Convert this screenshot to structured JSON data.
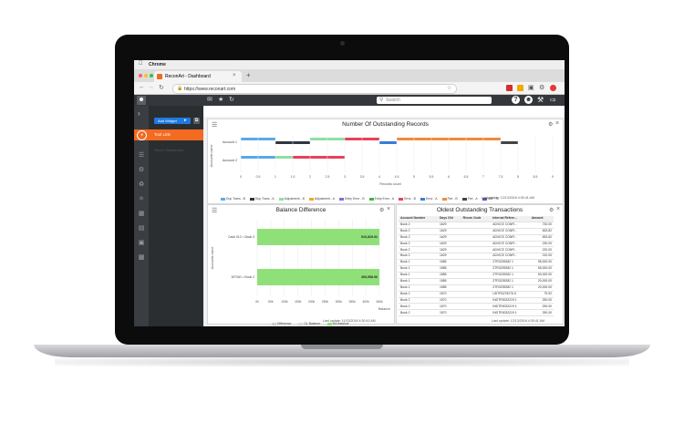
{
  "os": {
    "app_name": "Chrome"
  },
  "browser": {
    "tab_title": "ReconArt - Dashboard",
    "new_tab": "+",
    "url": "https://www.reconart.com"
  },
  "app": {
    "search_placeholder": "Search",
    "add_widget_label": "Add Widget",
    "sidebar_active": "Tool Link",
    "sidebar_sub": "Recon Dashboard"
  },
  "panels": {
    "records_title": "Number Of Outstanding Records",
    "records_ylabel": "Accounts name",
    "records_xlabel": "Records count",
    "last_update": "Last update: 12/13/2018 4:30:41 AM",
    "balance_title": "Balance Difference",
    "balance_ylabel": "Accounts name",
    "balance_xlabel": "Balance",
    "balance_last_update": "Last update: 11/13/2018 4:30:41 AM",
    "oldest_title": "Oldest Outstanding Transactions",
    "oldest_last_update": "Last update: 12/13/2018 4:30:41 AM"
  },
  "colors": {
    "accent": "#f26b21",
    "primary": "#1f7ae0",
    "green": "#90e07a",
    "dark": "#2b2e31"
  },
  "chart_data": [
    {
      "type": "bar",
      "orientation": "horizontal",
      "stacked": true,
      "title": "Number Of Outstanding Records",
      "categories": [
        "Account 1",
        "Account 2"
      ],
      "xlabel": "Records count",
      "ylabel": "Accounts name",
      "xticks": [
        "0",
        "0.5",
        "1",
        "1.5",
        "2",
        "2.5",
        "3",
        "3.5",
        "4",
        "4.5",
        "5",
        "5.5",
        "6",
        "6.5",
        "7",
        "7.5",
        "8",
        "8.5",
        "9"
      ],
      "xlim": [
        0,
        9
      ],
      "series": [
        {
          "name": "Dup Trans - B",
          "color": "#5aa9e6",
          "values": [
            1,
            1
          ]
        },
        {
          "name": "Dup Trans - A",
          "color": "#2f3540",
          "values": [
            1,
            0
          ]
        },
        {
          "name": "Adjustment - B",
          "color": "#8fe0a0",
          "values": [
            1,
            0.5
          ]
        },
        {
          "name": "Adjustment - A",
          "color": "#f5a623",
          "values": [
            0,
            0
          ]
        },
        {
          "name": "Entry Error - B",
          "color": "#7b6fd6",
          "values": [
            0,
            0
          ]
        },
        {
          "name": "Entry Error - A",
          "color": "#3bb54a",
          "values": [
            0,
            0
          ]
        },
        {
          "name": "Error - B",
          "color": "#e6415a",
          "values": [
            1,
            1.5
          ]
        },
        {
          "name": "Error - A",
          "color": "#3a7bd5",
          "values": [
            0.5,
            0
          ]
        },
        {
          "name": "Fee - B",
          "color": "#f18a3c",
          "values": [
            3,
            0
          ]
        },
        {
          "name": "Fee - A",
          "color": "#444444",
          "values": [
            0.5,
            0
          ]
        },
        {
          "name": "NSF - B",
          "color": "#6a4fb3",
          "values": [
            0,
            0
          ]
        },
        {
          "name": "NSF - A",
          "color": "#222222",
          "values": [
            0,
            0
          ]
        },
        {
          "name": "Timing Delay - B",
          "color": "#4cc3d9",
          "values": [
            0,
            0
          ]
        },
        {
          "name": "Timing Delay - A",
          "color": "#f2c94c",
          "values": [
            0,
            0
          ]
        },
        {
          "name": "Bank Fees - B",
          "color": "#8e44ad",
          "values": [
            0,
            0
          ]
        },
        {
          "name": "Bank Fees - A",
          "color": "#e74c8c",
          "values": [
            0,
            0
          ]
        }
      ],
      "legend": "bottom"
    },
    {
      "type": "bar",
      "orientation": "horizontal",
      "title": "Balance Difference",
      "categories": [
        "Cash 012 = Book 3",
        "WT040 = Book 2"
      ],
      "xlabel": "Balance",
      "ylabel": "Accounts name",
      "xticks": [
        "0k",
        "50k",
        "100k",
        "150k",
        "200k",
        "250k",
        "300k",
        "350k",
        "400k",
        "450k"
      ],
      "xlim": [
        0,
        450000
      ],
      "series": [
        {
          "name": "BA Balance",
          "color": "#90e07a",
          "values": [
            516829.92,
            493958.96
          ],
          "labels": [
            "516,829.92",
            "493,958.96"
          ]
        }
      ],
      "legend_items": [
        "Difference",
        "GL Balance",
        "BA Balance"
      ],
      "legend": "bottom"
    },
    {
      "type": "table",
      "title": "Oldest Outstanding Transactions",
      "columns": [
        "Account Number",
        "Days Old",
        "Recon Code",
        "Internal Refere...",
        "Amount"
      ],
      "rows": [
        [
          "Book 2",
          "1629",
          "",
          "ADVICE CONFI...",
          "730.00"
        ],
        [
          "Book 2",
          "1629",
          "",
          "ADVICE CONFI...",
          "653.82"
        ],
        [
          "Book 2",
          "1629",
          "",
          "ADVICE CONFI...",
          "653.82"
        ],
        [
          "Book 2",
          "1629",
          "",
          "ADVICE CONFI...",
          "230.00"
        ],
        [
          "Book 2",
          "1629",
          "",
          "ADVICE CONFI...",
          "220.00"
        ],
        [
          "Book 2",
          "1629",
          "",
          "ADVICE CONFI...",
          "210.00"
        ],
        [
          "Book 1",
          "1585",
          "",
          "ZTR3239282 1",
          "55,000.00"
        ],
        [
          "Book 1",
          "1585",
          "",
          "ZTR3239282 1",
          "55,000.00"
        ],
        [
          "Book 1",
          "1585",
          "",
          "ZTR3239282 1",
          "50,000.00"
        ],
        [
          "Book 1",
          "1585",
          "",
          "ZTR3239282 1",
          "20,000.00"
        ],
        [
          "Book 1",
          "1585",
          "",
          "ZTR3239282 1",
          "20,000.00"
        ],
        [
          "Book 2",
          "1570",
          "",
          "UDTR3275276 5",
          "79.92"
        ],
        [
          "Book 2",
          "1570",
          "",
          "INDTR3032219 1",
          "250.00"
        ],
        [
          "Book 2",
          "1570",
          "",
          "INDTR3032219 1",
          "250.00"
        ],
        [
          "Book 2",
          "1570",
          "",
          "INDTR3032219 1",
          "250.00"
        ]
      ]
    }
  ]
}
